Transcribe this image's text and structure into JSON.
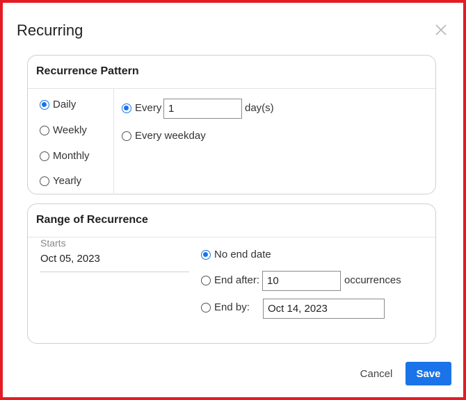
{
  "dialog": {
    "title": "Recurring",
    "close_icon": "close-icon"
  },
  "pattern": {
    "title": "Recurrence Pattern",
    "frequencies": [
      {
        "label": "Daily",
        "checked": true
      },
      {
        "label": "Weekly",
        "checked": false
      },
      {
        "label": "Monthly",
        "checked": false
      },
      {
        "label": "Yearly",
        "checked": false
      }
    ],
    "every_label": "Every",
    "every_value": "1",
    "days_suffix": "day(s)",
    "every_weekday_label": "Every weekday"
  },
  "range": {
    "title": "Range of Recurrence",
    "starts_label": "Starts",
    "starts_value": "Oct 05, 2023",
    "no_end_label": "No end date",
    "end_after_label": "End after:",
    "end_after_value": "10",
    "occurrences_suffix": "occurrences",
    "end_by_label": "End by:",
    "end_by_value": "Oct 14, 2023"
  },
  "footer": {
    "cancel_label": "Cancel",
    "save_label": "Save"
  },
  "colors": {
    "accent": "#1a73e8",
    "frame": "#e31b23"
  }
}
